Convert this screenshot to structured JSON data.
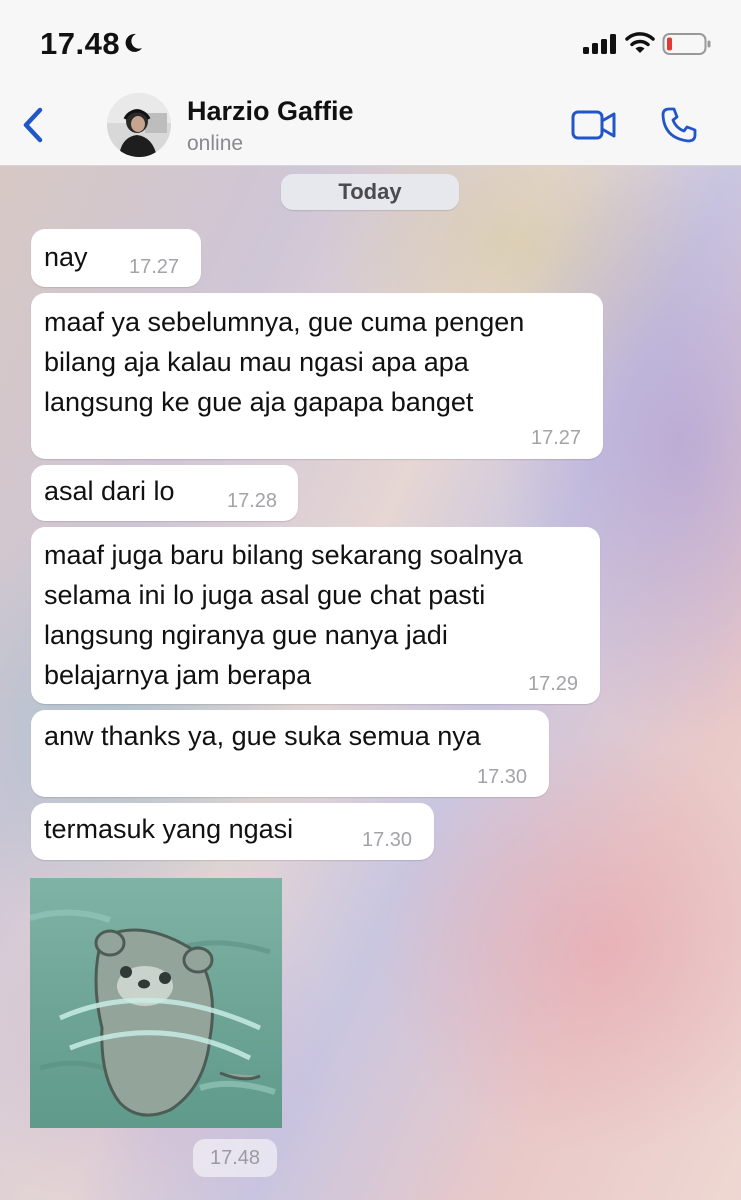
{
  "status_bar": {
    "time": "17.48",
    "icons": [
      "moon-icon",
      "signal-icon",
      "wifi-icon",
      "battery-icon"
    ],
    "battery_color": "#e53935"
  },
  "header": {
    "contact_name": "Harzio Gaffie",
    "contact_status": "online",
    "accent_color": "#2156c9",
    "icons": [
      "back-icon",
      "video-call-icon",
      "phone-call-icon"
    ]
  },
  "chat": {
    "date_label": "Today",
    "messages": [
      {
        "lines": "nay",
        "time": "17.27"
      },
      {
        "lines": "maaf ya sebelumnya, gue cuma pengen\nbilang aja kalau mau ngasi apa apa\nlangsung ke gue aja gapapa banget",
        "time": "17.27"
      },
      {
        "lines": "asal dari lo",
        "time": "17.28"
      },
      {
        "lines": "maaf juga baru bilang sekarang soalnya\nselama ini lo juga asal gue chat pasti\nlangsung ngiranya gue nanya jadi\nbelajarnya jam berapa",
        "time": "17.29"
      },
      {
        "lines": "anw thanks ya, gue suka semua nya",
        "time": "17.30"
      },
      {
        "lines": "termasuk yang ngasi",
        "time": "17.30"
      }
    ],
    "image_message": {
      "content": "otter-sticker-image",
      "time": "17.48"
    }
  }
}
